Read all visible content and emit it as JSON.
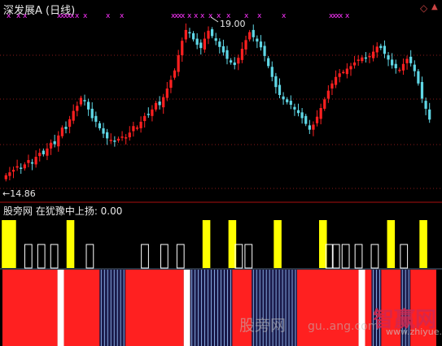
{
  "header": {
    "title": "深发展A (日线)"
  },
  "indicator": {
    "label": "股旁网  在犹豫中上扬: 0.00"
  },
  "price_annotations": {
    "high": "19.00",
    "low": "←14.86"
  },
  "watermark": {
    "cn": "股旁网",
    "url_text": "gu..ang.com",
    "brand": "智赢网",
    "brand_url": "www.zhiyue.com"
  },
  "controls": {
    "diamond": "◇",
    "up": "▲"
  },
  "colors": {
    "bg": "#000000",
    "up": "#5fd7e6",
    "down": "#ff2020",
    "marker": "#ff33ff",
    "yellow": "#ffff00",
    "white": "#ffffff",
    "separator": "#aa1111"
  },
  "chart_data": {
    "type": "candlestick",
    "ylim": [
      14.5,
      19.4
    ],
    "closes": [
      15.0,
      15.08,
      15.15,
      15.25,
      15.19,
      15.3,
      15.42,
      15.32,
      15.51,
      15.62,
      15.58,
      15.74,
      15.9,
      15.86,
      16.1,
      16.32,
      16.28,
      16.55,
      16.78,
      16.92,
      17.14,
      17.05,
      16.82,
      16.58,
      16.48,
      16.3,
      16.15,
      16.02,
      15.98,
      15.94,
      16.01,
      16.07,
      16.05,
      16.18,
      16.36,
      16.32,
      16.48,
      16.64,
      16.68,
      16.82,
      17.0,
      16.94,
      17.16,
      17.4,
      17.64,
      17.9,
      18.32,
      18.72,
      19.02,
      18.95,
      18.76,
      18.61,
      18.52,
      18.78,
      19.0,
      18.85,
      18.72,
      18.55,
      18.4,
      18.22,
      18.12,
      18.05,
      18.25,
      18.5,
      18.74,
      18.96,
      18.82,
      18.7,
      18.54,
      18.3,
      18.02,
      17.72,
      17.44,
      17.22,
      17.1,
      17.02,
      16.95,
      16.82,
      16.72,
      16.58,
      16.42,
      16.26,
      16.4,
      16.62,
      16.86,
      17.1,
      17.34,
      17.54,
      17.72,
      17.82,
      17.86,
      17.95,
      18.02,
      18.12,
      18.2,
      18.26,
      18.24,
      18.3,
      18.42,
      18.56,
      18.52,
      18.36,
      18.2,
      18.04,
      17.96,
      17.92,
      18.08,
      18.22,
      18.1,
      17.88,
      17.54,
      17.12,
      16.84,
      16.54
    ],
    "markers": [
      "x",
      "x",
      "x",
      "x",
      "x",
      "x",
      "x",
      "x",
      "x",
      "x",
      "x",
      "x",
      "x",
      "x",
      "x",
      "x",
      "x",
      "x",
      "x",
      "x",
      "x",
      "x",
      "x",
      "x",
      "x",
      "x",
      "x",
      "x",
      "x",
      "x"
    ],
    "high_label": 19.0,
    "low_label": 14.86
  },
  "indicator_data": {
    "yellow_bars": [
      1,
      3,
      21,
      63,
      71,
      85,
      99,
      120,
      130
    ],
    "hollow_bars": [
      8,
      12,
      16,
      27,
      44,
      50,
      55,
      73,
      76,
      101,
      103,
      106,
      110,
      115,
      124
    ],
    "blocks": [
      {
        "from": 0,
        "to": 16,
        "c": "red"
      },
      {
        "from": 17,
        "to": 18,
        "c": "white"
      },
      {
        "from": 19,
        "to": 29,
        "c": "red"
      },
      {
        "from": 30,
        "to": 37,
        "c": "blue"
      },
      {
        "from": 38,
        "to": 55,
        "c": "red"
      },
      {
        "from": 56,
        "to": 57,
        "c": "white"
      },
      {
        "from": 58,
        "to": 70,
        "c": "blue"
      },
      {
        "from": 71,
        "to": 76,
        "c": "red"
      },
      {
        "from": 77,
        "to": 90,
        "c": "blue"
      },
      {
        "from": 91,
        "to": 109,
        "c": "red"
      },
      {
        "from": 110,
        "to": 111,
        "c": "white"
      },
      {
        "from": 112,
        "to": 113,
        "c": "red"
      },
      {
        "from": 114,
        "to": 116,
        "c": "blue"
      },
      {
        "from": 117,
        "to": 122,
        "c": "red"
      },
      {
        "from": 123,
        "to": 125,
        "c": "blue"
      },
      {
        "from": 126,
        "to": 133,
        "c": "red"
      }
    ]
  }
}
